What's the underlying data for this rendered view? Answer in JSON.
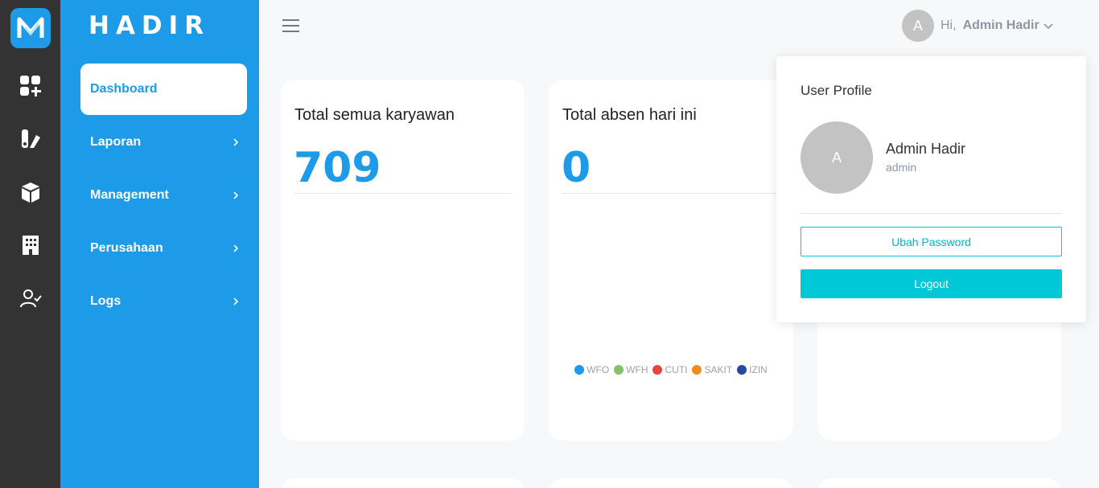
{
  "app": {
    "brand": "HADIR"
  },
  "rail": {
    "icons": [
      "app-logo-icon",
      "dashboard-add-icon",
      "report-icon",
      "box-icon",
      "building-icon",
      "user-check-icon"
    ]
  },
  "nav": {
    "items": [
      {
        "label": "Dashboard",
        "active": true
      },
      {
        "label": "Laporan"
      },
      {
        "label": "Management"
      },
      {
        "label": "Perusahaan"
      },
      {
        "label": "Logs"
      }
    ]
  },
  "header": {
    "avatar_initial": "A",
    "greeting": "Hi,",
    "user_name": "Admin Hadir"
  },
  "cards": [
    {
      "title": "Total semua karyawan",
      "value": "709"
    },
    {
      "title": "Total absen hari ini",
      "value": "0"
    }
  ],
  "legend": [
    {
      "label": "WFO",
      "color": "#1e9be8"
    },
    {
      "label": "WFH",
      "color": "#86c06a"
    },
    {
      "label": "CUTI",
      "color": "#e8433c"
    },
    {
      "label": "SAKIT",
      "color": "#f08c1d"
    },
    {
      "label": "IZIN",
      "color": "#254a9e"
    }
  ],
  "profile": {
    "title": "User Profile",
    "avatar_initial": "A",
    "name": "Admin Hadir",
    "role": "admin",
    "change_password_label": "Ubah Password",
    "logout_label": "Logout"
  },
  "colors": {
    "primary": "#1e9be8",
    "rail": "#333333",
    "accent": "#00c8d7"
  }
}
